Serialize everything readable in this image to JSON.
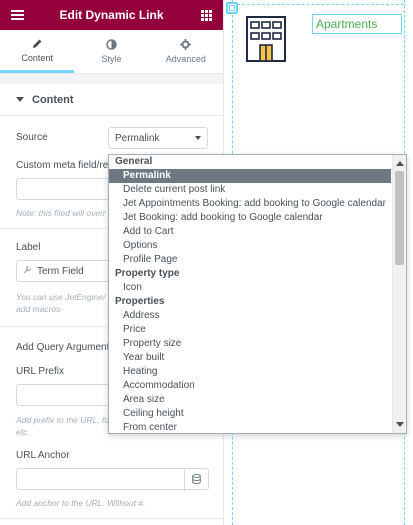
{
  "header": {
    "title": "Edit Dynamic Link"
  },
  "tabs": [
    {
      "label": "Content",
      "icon": "pencil-icon",
      "active": true
    },
    {
      "label": "Style",
      "icon": "contrast-icon",
      "active": false
    },
    {
      "label": "Advanced",
      "icon": "gear-icon",
      "active": false
    }
  ],
  "section": {
    "title": "Content"
  },
  "fields": {
    "source_label": "Source",
    "source_value": "Permalink",
    "custom_meta_label": "Custom meta field/rep",
    "custom_meta_note": "Note: this filed will overr",
    "label_label": "Label",
    "label_value": "Term Field",
    "label_note_line1": "You can use JetEngine/",
    "label_note_line2": "add macros",
    "query_args_label": "Add Query Arguments",
    "url_prefix_label": "URL Prefix",
    "url_prefix_note_line1": "Add prefix to the URL, fo",
    "url_prefix_note_line2": "etc.",
    "url_anchor_label": "URL Anchor",
    "url_anchor_note": "Add anchor to the URL. Without #."
  },
  "canvas": {
    "link_text": "Apartments"
  },
  "dropdown": {
    "groups": [
      {
        "name": "General",
        "items": [
          "Permalink",
          "Delete current post link",
          "Jet Appointments Booking: add booking to Google calendar",
          "Jet Booking: add booking to Google calendar",
          "Add to Cart",
          "Options",
          "Profile Page"
        ]
      },
      {
        "name": "Property type",
        "items": [
          "Icon"
        ]
      },
      {
        "name": "Properties",
        "items": [
          "Address",
          "Price",
          "Property size",
          "Year built",
          "Heating",
          "Accommodation",
          "Area size",
          "Ceiling height",
          "From center"
        ]
      }
    ],
    "selected": "Permalink"
  },
  "colors": {
    "brand": "#93003c",
    "accent": "#71d7f7",
    "link_green": "#4caf50",
    "selected_bg": "#6d7882"
  }
}
